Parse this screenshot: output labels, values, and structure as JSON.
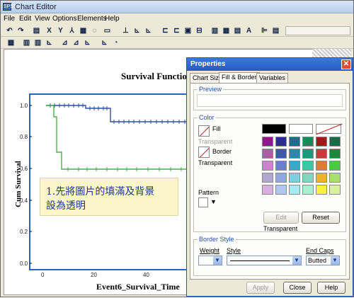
{
  "window": {
    "title": "Chart Editor",
    "app_icon_label": "SPSS"
  },
  "menu": [
    "File",
    "Edit",
    "View",
    "Options",
    "Elements",
    "Help"
  ],
  "chart": {
    "title": "Survival Function",
    "ylabel": "Cum Survival",
    "xlabel": "Event6_Survival_Time",
    "yticks": [
      "1.0",
      "0.8",
      "0.6",
      "0.4",
      "0.2",
      "0.0"
    ],
    "xticks": [
      "0",
      "20",
      "40"
    ]
  },
  "callout": {
    "line1": "1.先將圖片的填滿及背景",
    "line2": "設為透明"
  },
  "dialog": {
    "title": "Properties",
    "tabs": [
      "Chart Size",
      "Fill & Border",
      "Variables"
    ],
    "preview_label": "Preview",
    "color_label": "Color",
    "fill_label": "Fill",
    "fill_value": "Transparent",
    "border_label": "Border",
    "border_value": "Transparent",
    "pattern_label": "Pattern",
    "edit_label": "Edit",
    "reset_label": "Reset",
    "swatch_caption": "Transparent",
    "border_style_label": "Border Style",
    "weight_label": "Weight",
    "style_label": "Style",
    "endcaps_label": "End Caps",
    "endcaps_value": "Butted",
    "apply_label": "Apply",
    "close_label": "Close",
    "help_label": "Help"
  },
  "palette": [
    "#000000",
    "#ffffff",
    "#ffffff",
    "#8e1a8e",
    "#2e2e8e",
    "#1f6c8c",
    "#1a8a5a",
    "#a01a1a",
    "#1a6a4a",
    "#b05aa8",
    "#3c5aa8",
    "#2a8aa8",
    "#1a9a7a",
    "#c83a3a",
    "#1a8a3a",
    "#d27fcf",
    "#6a7fcf",
    "#3aa8c8",
    "#3ac8a8",
    "#e07a3a",
    "#4ac84a",
    "#b0a8d0",
    "#90a8e0",
    "#7ad0e0",
    "#80d8c0",
    "#f0b030",
    "#a8e070",
    "#d8b0e0",
    "#b0c8f0",
    "#a8e8f0",
    "#a8f0d0",
    "#f8f040",
    "#d8f0a0"
  ],
  "colors": {
    "series1": "#2f4f9f",
    "series2": "#43b743",
    "axis_frame": "#2563c0"
  }
}
